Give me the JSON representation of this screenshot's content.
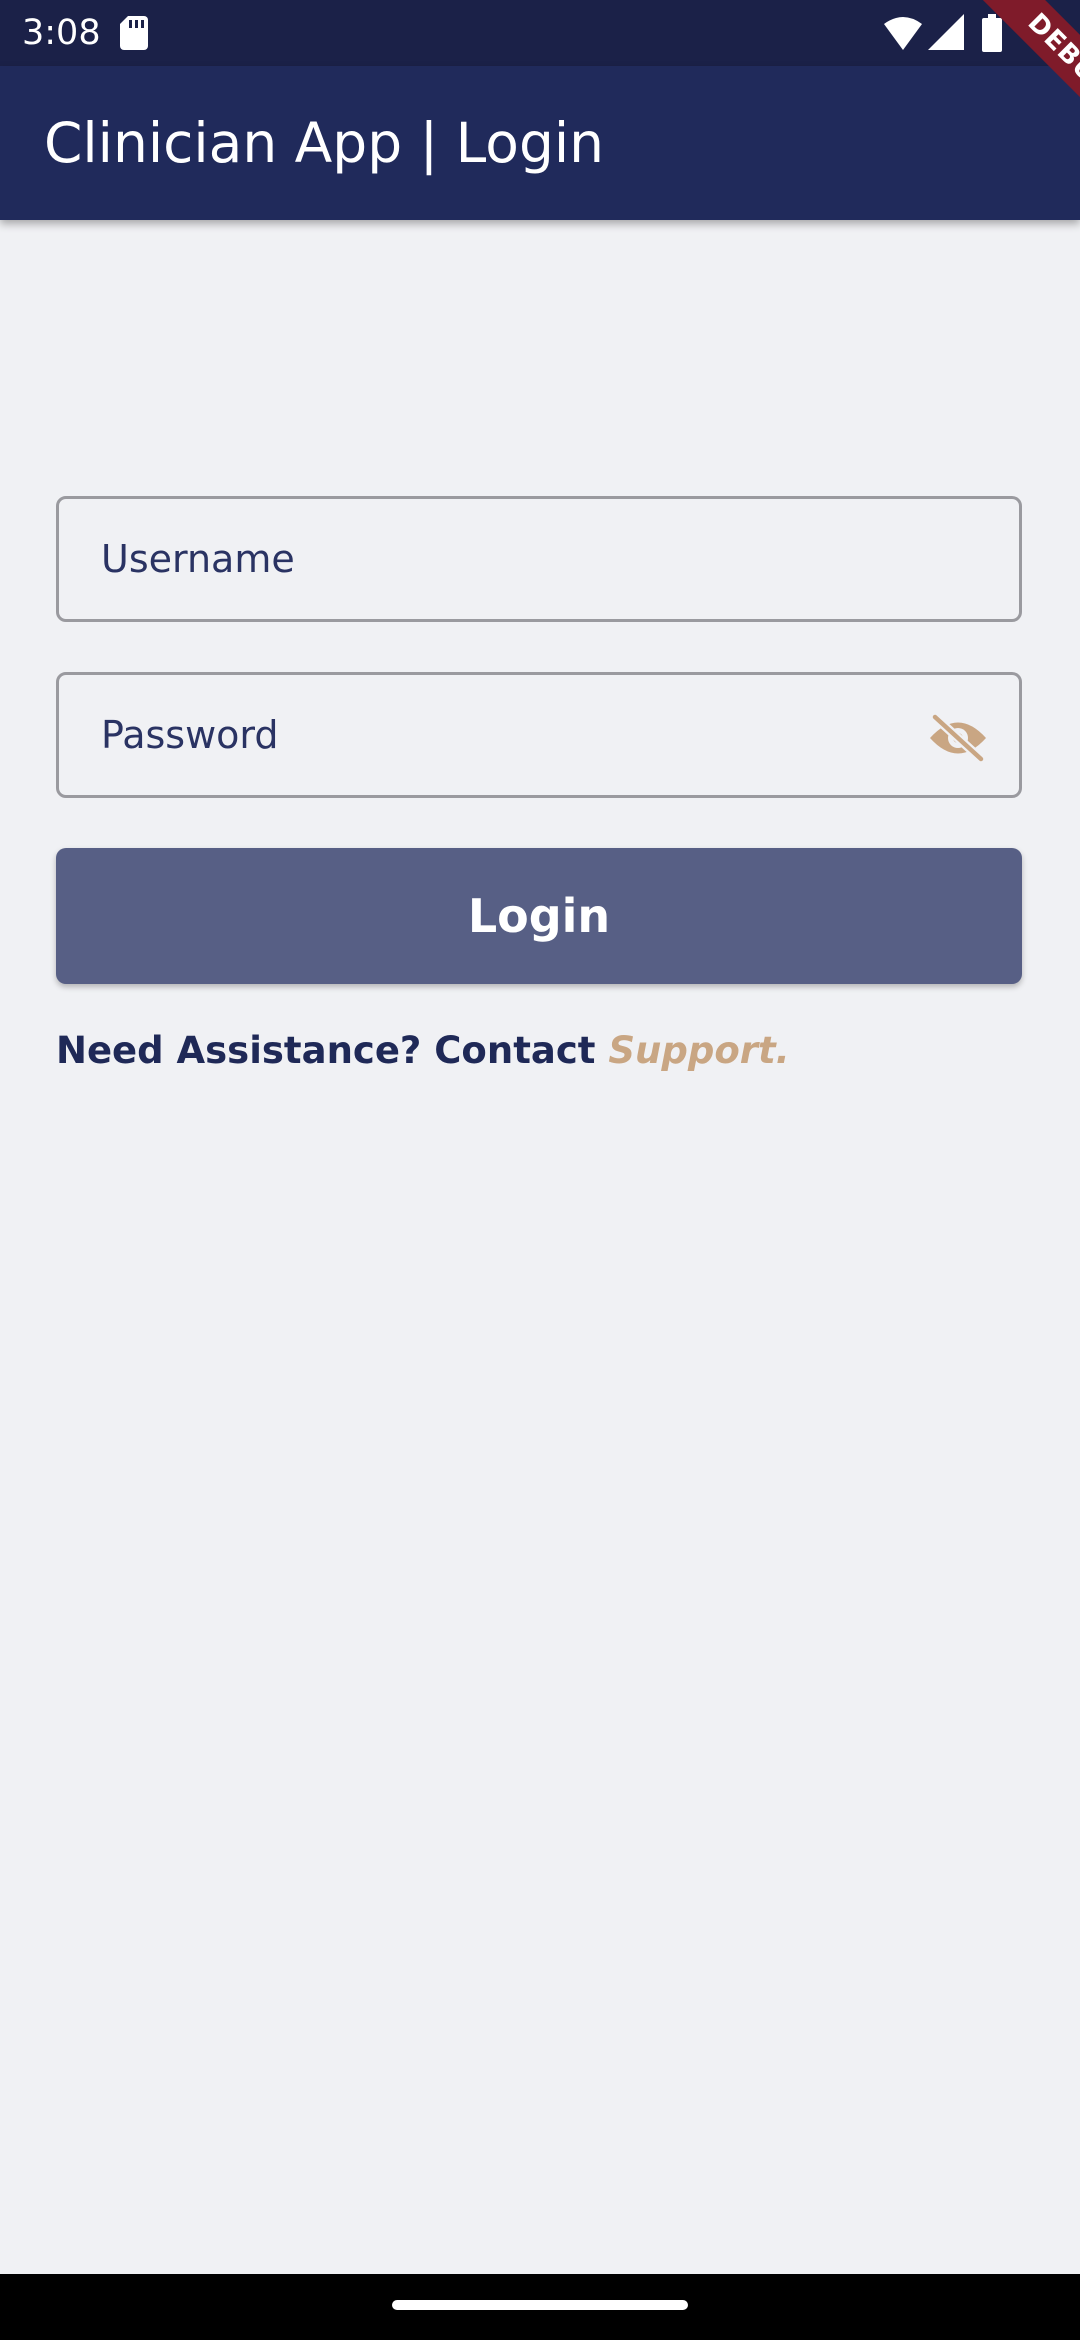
{
  "status_bar": {
    "time": "3:08",
    "icons": [
      "sd-card-icon",
      "wifi-icon",
      "signal-icon",
      "battery-icon"
    ]
  },
  "app_bar": {
    "title": "Clinician App | Login",
    "debug_label": "DEBUG"
  },
  "form": {
    "username": {
      "placeholder": "Username",
      "value": ""
    },
    "password": {
      "placeholder": "Password",
      "value": "",
      "toggle_icon": "visibility-off-icon"
    },
    "login_label": "Login"
  },
  "assistance": {
    "text": "Need Assistance? Contact ",
    "link_label": "Support."
  },
  "colors": {
    "app_bar": "#202a5b",
    "status_bar": "#1b2148",
    "background": "#f0f1f4",
    "button": "#575f85",
    "accent": "#c9a683",
    "text_primary": "#1f2957",
    "debug": "#7f1b2a"
  }
}
